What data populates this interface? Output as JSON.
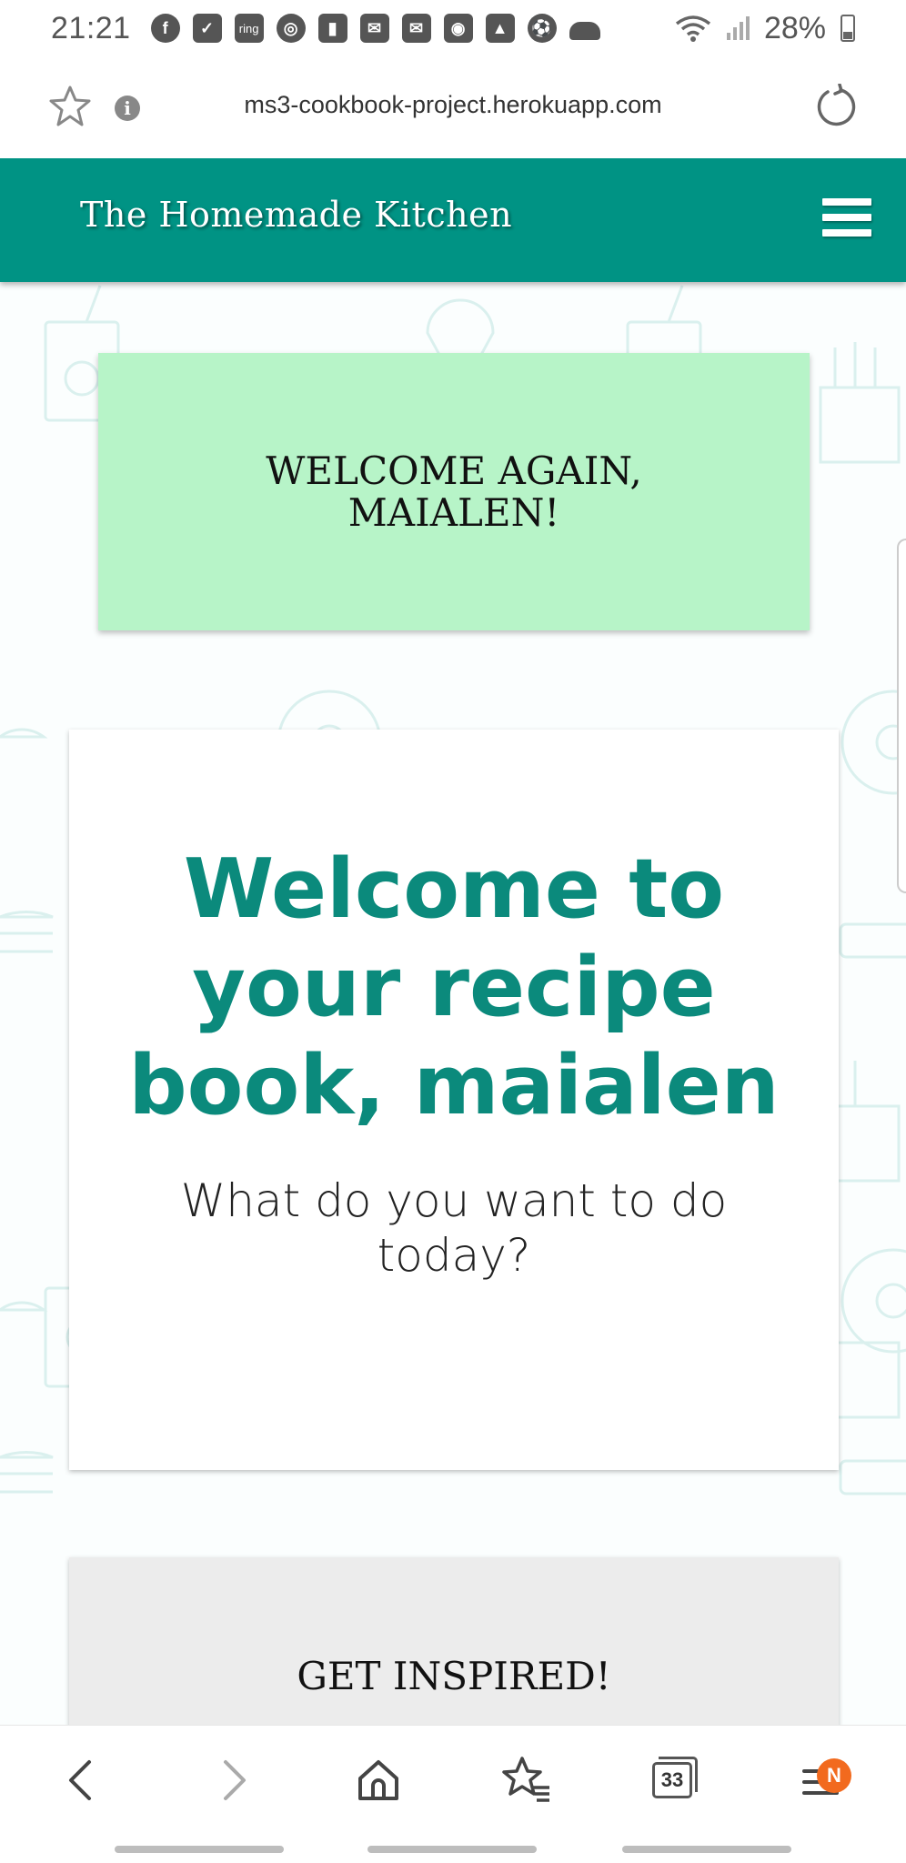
{
  "status_bar": {
    "time": "21:21",
    "battery": "28%",
    "notification_icons": [
      "facebook-icon",
      "shield-check-icon",
      "ring-icon",
      "chrome-icon",
      "twitch-icon",
      "mail-icon",
      "mail-icon",
      "instagram-icon",
      "gallery-icon",
      "football-icon",
      "cloud-icon"
    ],
    "ring_label": "ring"
  },
  "browser": {
    "url": "ms3-cookbook-project.herokuapp.com",
    "tab_count": "33",
    "menu_badge": "N"
  },
  "navbar": {
    "brand": "The Homemade Kitchen"
  },
  "welcome_card": {
    "text": "WELCOME AGAIN, MAIALEN!"
  },
  "recipe_card": {
    "title": "Welcome to your recipe book, maialen",
    "subtitle": "What do you want to do today?"
  },
  "inspire_card": {
    "text": "GET INSPIRED!"
  },
  "colors": {
    "brand_teal": "#009384",
    "heading_teal": "#0b8a7c",
    "welcome_green": "#b7f4c8",
    "inspire_grey": "#ececec",
    "badge_orange": "#f26a1e"
  }
}
